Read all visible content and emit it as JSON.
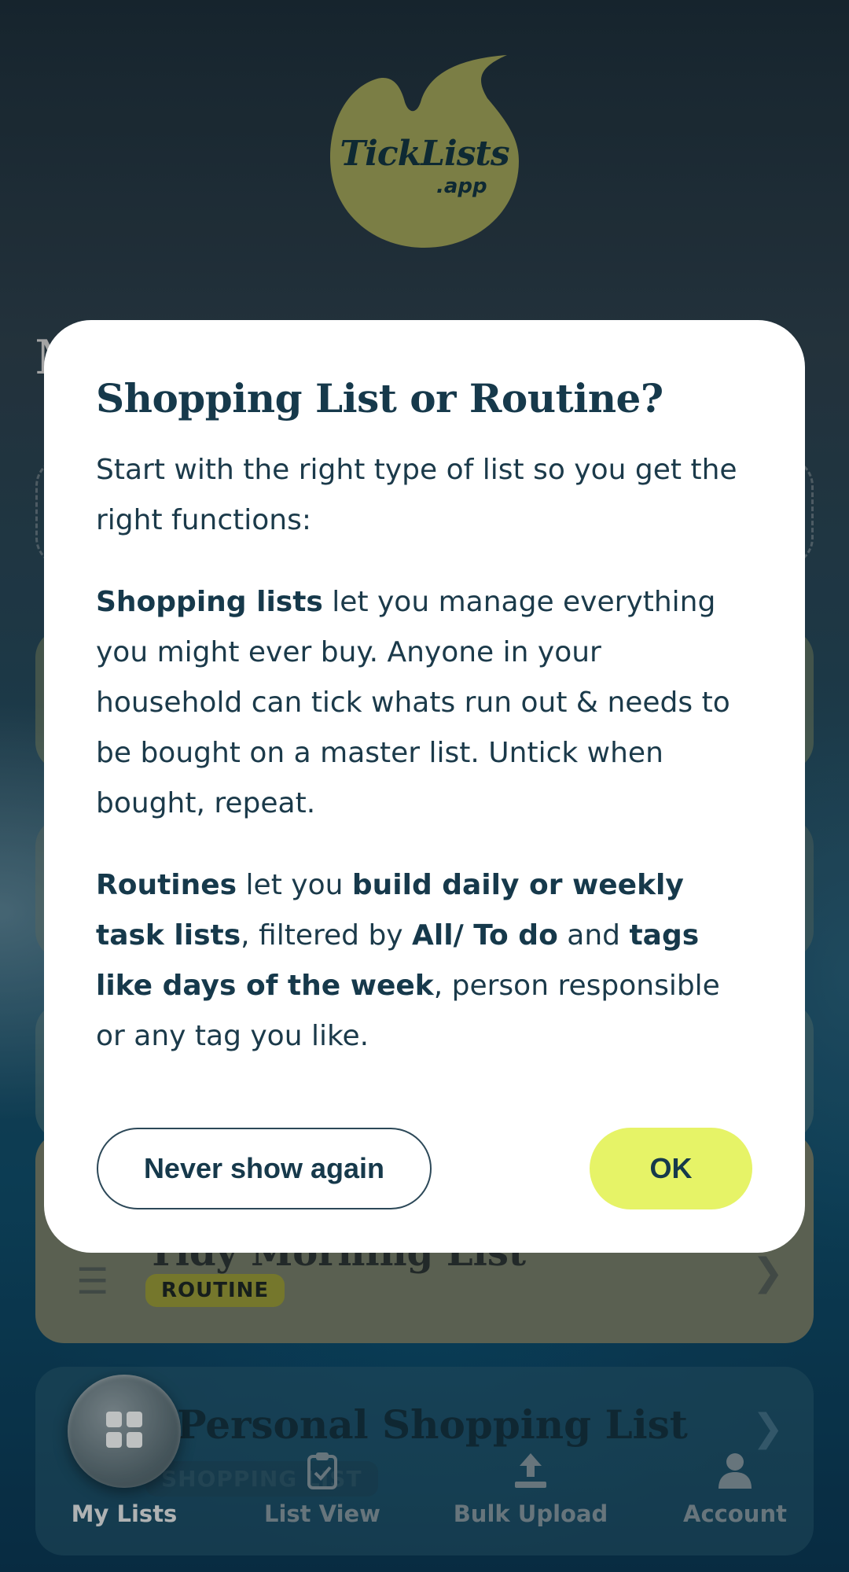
{
  "app": {
    "logo_text": "TickLists",
    "logo_sub": ".app",
    "background_heading": "M"
  },
  "list_cards": [
    {
      "title": "Tidy Morning List",
      "badge": "ROUTINE"
    },
    {
      "title": "Personal Shopping List",
      "badge": "SHOPPING LIST"
    }
  ],
  "nav": {
    "items": [
      {
        "label": "My Lists",
        "icon": "grid-icon",
        "active": true
      },
      {
        "label": "List View",
        "icon": "clipboard-check-icon"
      },
      {
        "label": "Bulk Upload",
        "icon": "upload-icon"
      },
      {
        "label": "Account",
        "icon": "user-icon"
      }
    ]
  },
  "modal": {
    "title": "Shopping List or Routine?",
    "intro": "Start with the right type of list so you get the right functions:",
    "shopping_bold": "Shopping lists",
    "shopping_text": " let you manage everything you might ever buy. Anyone in your household can tick whats run out & needs to be bought on a master list. Untick when bought, repeat.",
    "routines_bold": "Routines",
    "routines_t1": " let you ",
    "routines_b2": "build daily or weekly task lists",
    "routines_t2": ", filtered by ",
    "routines_b3": "All/ To do",
    "routines_t3": " and ",
    "routines_b4": "tags like days of the week",
    "routines_t4": ", person responsible or any tag you like.",
    "never_label": "Never show again",
    "ok_label": "OK"
  },
  "colors": {
    "logo": "#979a55",
    "ok_button": "#e6f367",
    "text_dark": "#16394b",
    "routine_badge": "#8f9236"
  }
}
